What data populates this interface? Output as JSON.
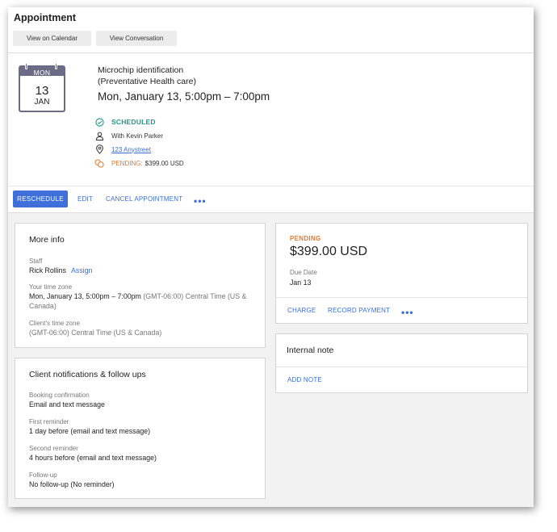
{
  "header": {
    "title": "Appointment",
    "view_calendar": "View on Calendar",
    "view_conversation": "View Conversation"
  },
  "appointment": {
    "calendar": {
      "weekday": "MON",
      "day": "13",
      "month": "JAN"
    },
    "service_line1": "Microchip identification",
    "service_line2": "(Preventative Health care)",
    "when": "Mon, January 13, 5:00pm – 7:00pm",
    "status": "SCHEDULED",
    "staff": "With Kevin Parker",
    "location": "123 Anystreet",
    "payment_status": "PENDING:",
    "payment_amount": "$399.00 USD"
  },
  "actions": {
    "reschedule": "RESCHEDULE",
    "edit": "EDIT",
    "cancel": "CANCEL APPOINTMENT",
    "more": "•••"
  },
  "more_info": {
    "title": "More info",
    "staff_label": "Staff",
    "staff_value": "Rick Rollins",
    "assign": "Assign",
    "your_tz_label": "Your time zone",
    "your_tz_time": "Mon, January 13, 5:00pm – 7:00pm",
    "your_tz_zone": "(GMT-06:00) Central Time (US & Canada)",
    "client_tz_label": "Client's time zone",
    "client_tz_value": "(GMT-06:00) Central Time (US & Canada)"
  },
  "notifications": {
    "title": "Client notifications & follow ups",
    "items": [
      {
        "label": "Booking confirmation",
        "value": "Email and text message"
      },
      {
        "label": "First reminder",
        "value": "1 day before (email and text message)"
      },
      {
        "label": "Second reminder",
        "value": "4 hours before (email and text message)"
      },
      {
        "label": "Follow-up",
        "value": "No follow-up (No reminder)"
      }
    ]
  },
  "payment": {
    "status": "PENDING",
    "amount": "$399.00 USD",
    "due_label": "Due Date",
    "due_value": "Jan 13",
    "charge": "CHARGE",
    "record_payment": "RECORD PAYMENT",
    "more": "•••"
  },
  "internal_note": {
    "title": "Internal note",
    "add_note": "ADD NOTE"
  },
  "colors": {
    "accent_blue": "#3f6fd8",
    "link_blue": "#3b6fd6",
    "pending_orange": "#e37a2f",
    "scheduled_teal": "#1a9a8a",
    "calendar_purple": "#6c6a85"
  },
  "icons": {
    "status": "check-circle-icon",
    "staff": "person-icon",
    "location": "map-pin-icon",
    "payment": "coins-icon",
    "calendar": "calendar-icon"
  }
}
